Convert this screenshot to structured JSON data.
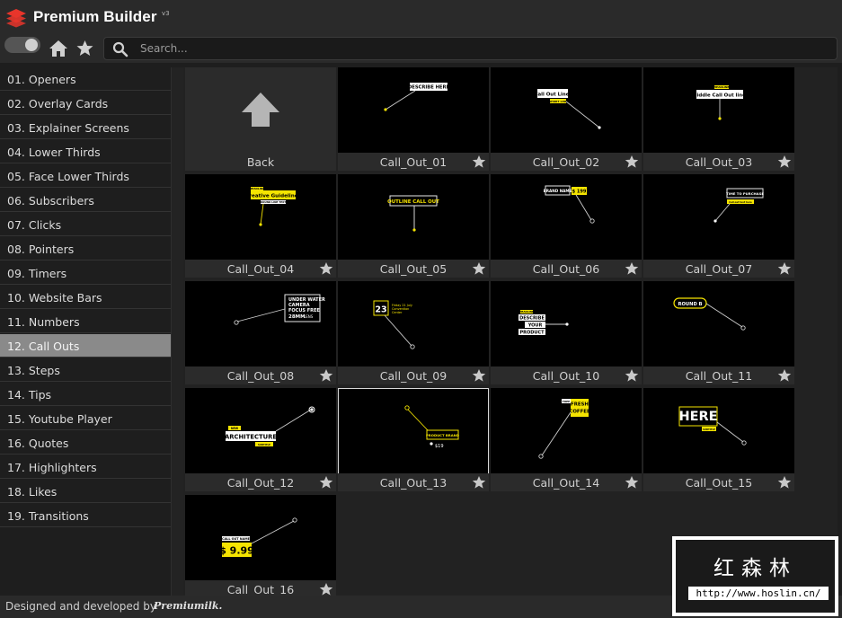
{
  "app": {
    "title": "Premium Builder",
    "version": "v3"
  },
  "search": {
    "placeholder": "Search..."
  },
  "categories": [
    "01. Openers",
    "02. Overlay Cards",
    "03. Explainer Screens",
    "04. Lower Thirds",
    "05. Face Lower Thirds",
    "06. Subscribers",
    "07. Clicks",
    "08. Pointers",
    "09. Timers",
    "10. Website Bars",
    "11. Numbers",
    "12. Call Outs",
    "13. Steps",
    "14. Tips",
    "15. Youtube Player",
    "16. Quotes",
    "17. Highlighters",
    "18. Likes",
    "19. Transitions"
  ],
  "active_category": "12. Call Outs",
  "back_label": "Back",
  "tiles": [
    {
      "label": "Call_Out_01",
      "texts": [
        "DESCRIBE HERE"
      ]
    },
    {
      "label": "Call_Out_02",
      "texts": [
        "Call Out Line.",
        "SHORT LINE"
      ]
    },
    {
      "label": "Call_Out_03",
      "texts": [
        "HEADLINE",
        "Middle Call Out line."
      ]
    },
    {
      "label": "Call_Out_04",
      "texts": [
        "HEADLINE",
        "Creative Guidelines",
        "ROUND LINE TEXT"
      ]
    },
    {
      "label": "Call_Out_05",
      "texts": [
        "OUTLINE CALL OUT"
      ]
    },
    {
      "label": "Call_Out_06",
      "texts": [
        "BRAND NAME",
        "$ 199"
      ]
    },
    {
      "label": "Call_Out_07",
      "texts": [
        "TIME TO PURCHASE",
        "Call out text here"
      ]
    },
    {
      "label": "Call_Out_08",
      "texts": [
        "UNDER WATER",
        "CAMERA",
        "FOCUS FREE",
        "28MM",
        "LENS"
      ]
    },
    {
      "label": "Call_Out_09",
      "texts": [
        "23",
        "Friday 21 July",
        "Convention",
        "Center"
      ]
    },
    {
      "label": "Call_Out_10",
      "texts": [
        "HEADLINE",
        "DESCRIBE",
        "YOUR",
        "PRODUCT"
      ]
    },
    {
      "label": "Call_Out_11",
      "texts": [
        "ROUND B"
      ]
    },
    {
      "label": "Call_Out_12",
      "texts": [
        "NEW",
        "ARCHITECTURE",
        "SUBTITLE"
      ]
    },
    {
      "label": "Call_Out_13",
      "texts": [
        "PRODUCT BRAND",
        "$19"
      ]
    },
    {
      "label": "Call_Out_14",
      "texts": [
        "FREE",
        "FRESH",
        "COFFEE"
      ]
    },
    {
      "label": "Call_Out_15",
      "texts": [
        "HERE",
        "SUBTITLE"
      ]
    },
    {
      "label": "Call_Out_16",
      "texts": [
        "CALL OUT NAME",
        "$ 9.99"
      ]
    }
  ],
  "selected_tile": "Call_Out_13",
  "footer": {
    "credit": "Designed and developed by",
    "brand": "Premiumilk."
  },
  "zoom": {
    "level": 0.48
  },
  "watermark": {
    "chinese": "红森林",
    "url": "http://www.hoslin.cn/"
  },
  "colors": {
    "accent_yellow": "#f5e400",
    "logo_red": "#e8352b",
    "active_item": "#8a8a8a"
  }
}
